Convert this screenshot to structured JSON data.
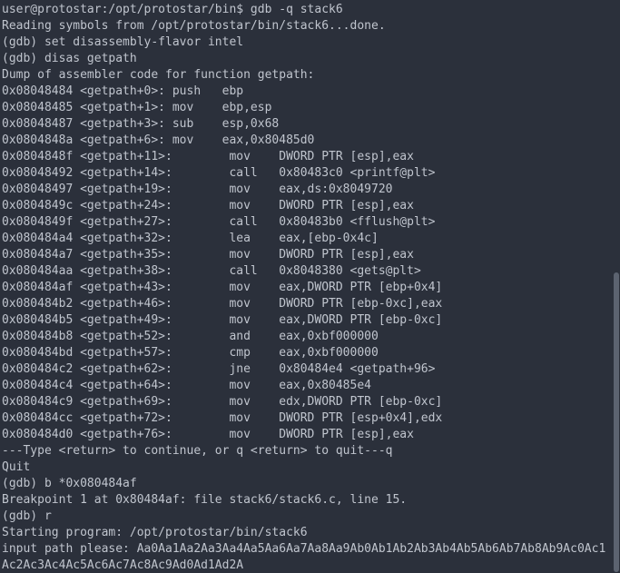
{
  "terminal": {
    "lines": [
      "user@protostar:/opt/protostar/bin$ gdb -q stack6",
      "Reading symbols from /opt/protostar/bin/stack6...done.",
      "(gdb) set disassembly-flavor intel",
      "(gdb) disas getpath",
      "Dump of assembler code for function getpath:",
      "0x08048484 <getpath+0>: push   ebp",
      "0x08048485 <getpath+1>: mov    ebp,esp",
      "0x08048487 <getpath+3>: sub    esp,0x68",
      "0x0804848a <getpath+6>: mov    eax,0x80485d0",
      "0x0804848f <getpath+11>:        mov    DWORD PTR [esp],eax",
      "0x08048492 <getpath+14>:        call   0x80483c0 <printf@plt>",
      "0x08048497 <getpath+19>:        mov    eax,ds:0x8049720",
      "0x0804849c <getpath+24>:        mov    DWORD PTR [esp],eax",
      "0x0804849f <getpath+27>:        call   0x80483b0 <fflush@plt>",
      "0x080484a4 <getpath+32>:        lea    eax,[ebp-0x4c]",
      "0x080484a7 <getpath+35>:        mov    DWORD PTR [esp],eax",
      "0x080484aa <getpath+38>:        call   0x8048380 <gets@plt>",
      "0x080484af <getpath+43>:        mov    eax,DWORD PTR [ebp+0x4]",
      "0x080484b2 <getpath+46>:        mov    DWORD PTR [ebp-0xc],eax",
      "0x080484b5 <getpath+49>:        mov    eax,DWORD PTR [ebp-0xc]",
      "0x080484b8 <getpath+52>:        and    eax,0xbf000000",
      "0x080484bd <getpath+57>:        cmp    eax,0xbf000000",
      "0x080484c2 <getpath+62>:        jne    0x80484e4 <getpath+96>",
      "0x080484c4 <getpath+64>:        mov    eax,0x80485e4",
      "0x080484c9 <getpath+69>:        mov    edx,DWORD PTR [ebp-0xc]",
      "0x080484cc <getpath+72>:        mov    DWORD PTR [esp+0x4],edx",
      "0x080484d0 <getpath+76>:        mov    DWORD PTR [esp],eax",
      "---Type <return> to continue, or q <return> to quit---q",
      "Quit",
      "(gdb) b *0x080484af",
      "Breakpoint 1 at 0x80484af: file stack6/stack6.c, line 15.",
      "(gdb) r",
      "Starting program: /opt/protostar/bin/stack6",
      "input path please: Aa0Aa1Aa2Aa3Aa4Aa5Aa6Aa7Aa8Aa9Ab0Ab1Ab2Ab3Ab4Ab5Ab6Ab7Ab8Ab9Ac0Ac1Ac2Ac3Ac4Ac5Ac6Ac7Ac8Ac9Ad0Ad1Ad2A"
    ]
  }
}
